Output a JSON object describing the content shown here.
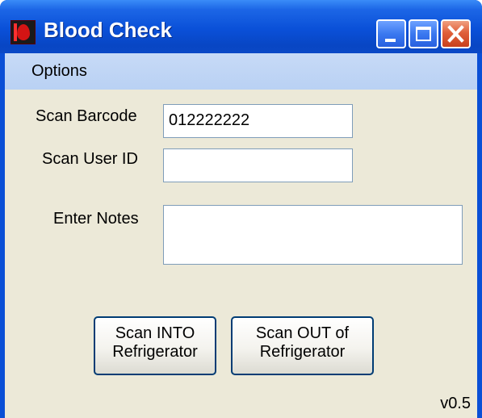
{
  "window": {
    "title": "Blood Check"
  },
  "menu": {
    "items": [
      "Options"
    ]
  },
  "form": {
    "barcode_label": "Scan Barcode",
    "barcode_value": "012222222",
    "userid_label": "Scan User ID",
    "userid_value": "",
    "notes_label": "Enter Notes",
    "notes_value": ""
  },
  "buttons": {
    "scan_in_line1": "Scan INTO",
    "scan_in_line2": "Refrigerator",
    "scan_out_line1": "Scan OUT of",
    "scan_out_line2": "Refrigerator"
  },
  "status": {
    "version": "v0.5"
  },
  "icons": {
    "app": "blood-drop-icon",
    "minimize": "minimize-icon",
    "maximize": "maximize-icon",
    "close": "close-icon"
  },
  "colors": {
    "titlebar": "#0a50d8",
    "menubar": "#c7daf6",
    "client": "#ece9d8",
    "close_button": "#e0603a"
  }
}
